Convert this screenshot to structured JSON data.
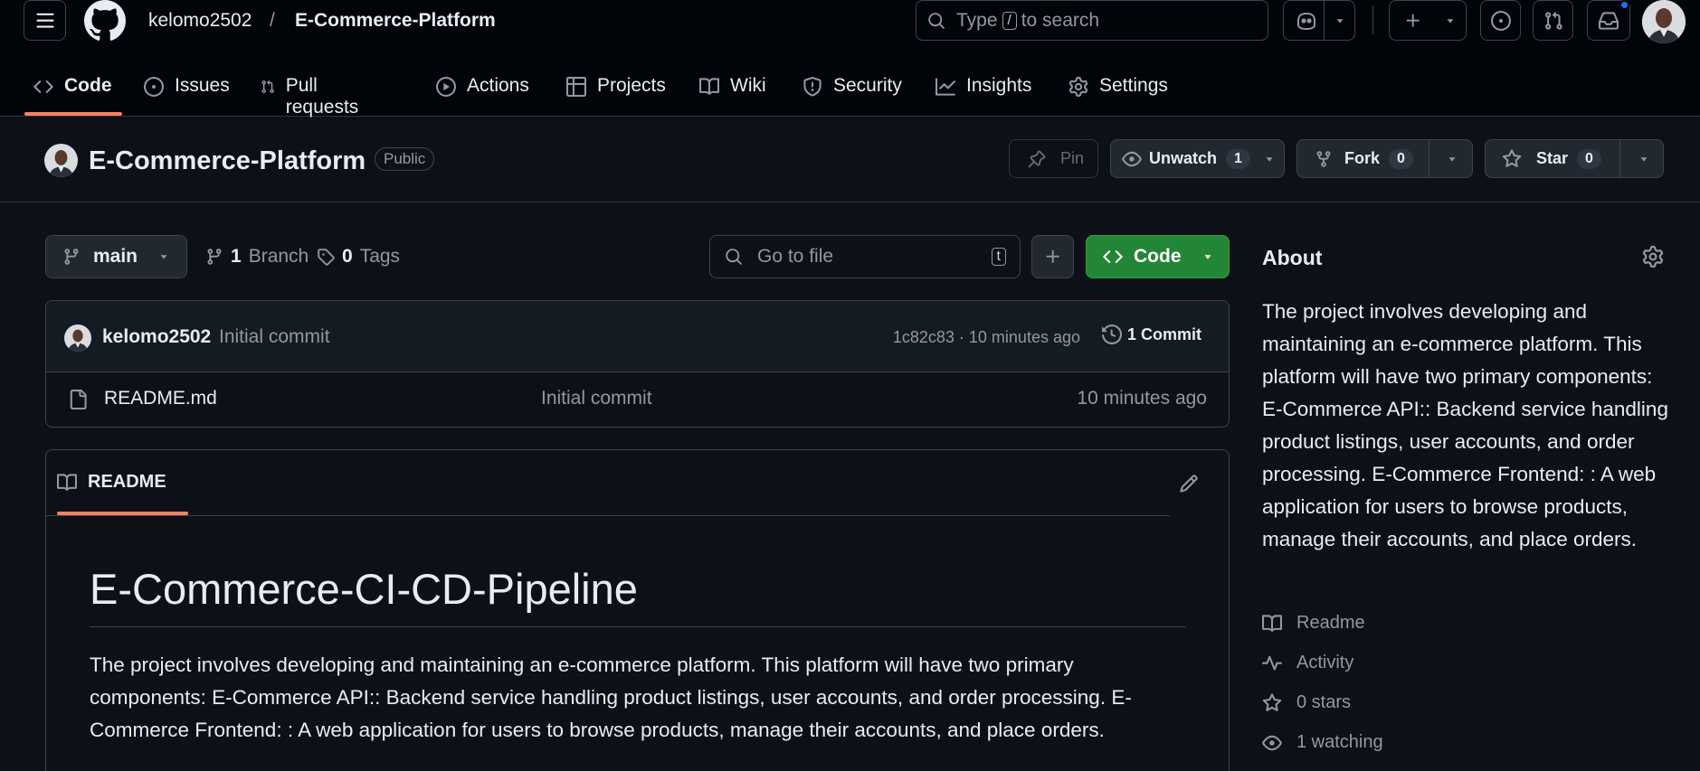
{
  "header": {
    "owner": "kelomo2502",
    "separator": "/",
    "repo": "E-Commerce-Platform",
    "search": {
      "prefix": "Type",
      "key": "/",
      "suffix": "to search"
    }
  },
  "nav": {
    "items": [
      {
        "label": "Code"
      },
      {
        "label": "Issues"
      },
      {
        "label": "Pull requests"
      },
      {
        "label": "Actions"
      },
      {
        "label": "Projects"
      },
      {
        "label": "Wiki"
      },
      {
        "label": "Security"
      },
      {
        "label": "Insights"
      },
      {
        "label": "Settings"
      }
    ]
  },
  "repo_header": {
    "name": "E-Commerce-Platform",
    "visibility": "Public",
    "pin_label": "Pin",
    "unwatch_label": "Unwatch",
    "watch_count": "1",
    "fork_label": "Fork",
    "fork_count": "0",
    "star_label": "Star",
    "star_count": "0"
  },
  "toolbar": {
    "branch": "main",
    "branch_count": "1",
    "branch_label": "Branch",
    "tag_count": "0",
    "tag_label": "Tags",
    "goto_placeholder": "Go to file",
    "goto_key": "t",
    "code_label": "Code"
  },
  "commit": {
    "author": "kelomo2502",
    "message": "Initial commit",
    "meta": "1c82c83 · 10 minutes ago",
    "count_label": "1 Commit"
  },
  "files": [
    {
      "name": "README.md",
      "message": "Initial commit",
      "time": "10 minutes ago"
    }
  ],
  "readme": {
    "tab_label": "README",
    "heading": "E-Commerce-CI-CD-Pipeline",
    "body": "The project involves developing and maintaining an e-commerce platform. This platform will have two primary components: E-Commerce API:: Backend service handling product listings, user accounts, and order processing. E-Commerce Frontend: : A web application for users to browse products, manage their accounts, and place orders."
  },
  "about": {
    "title": "About",
    "description": "The project involves developing and maintaining an e-commerce platform. This platform will have two primary components: E-Commerce API:: Backend service handling product listings, user accounts, and order processing. E-Commerce Frontend: : A web application for users to browse products, manage their accounts, and place orders.",
    "links": [
      {
        "label": "Readme",
        "icon": "book-icon"
      },
      {
        "label": "Activity",
        "icon": "pulse-icon"
      },
      {
        "label": "0 stars",
        "icon": "star-icon"
      },
      {
        "label": "1 watching",
        "icon": "eye-icon"
      }
    ]
  },
  "colors": {
    "background": "#0d1117",
    "header_background": "#010409",
    "accent_underline": "#f78166",
    "code_button": "#238636",
    "notification_dot": "#1f6feb"
  }
}
